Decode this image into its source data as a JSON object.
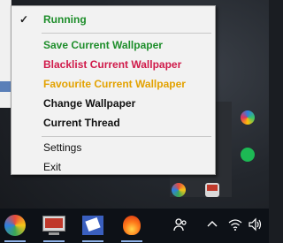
{
  "menu": {
    "items": [
      {
        "label": "Running",
        "color": "#1e8e2b",
        "bold": true,
        "checked": true
      },
      {
        "label": "Save Current Wallpaper",
        "color": "#1e8e2b",
        "bold": true
      },
      {
        "label": "Blacklist Current Wallpaper",
        "color": "#d01a4a",
        "bold": true
      },
      {
        "label": "Favourite Current Wallpaper",
        "color": "#e3a200",
        "bold": true
      },
      {
        "label": "Change Wallpaper",
        "color": "#111111",
        "bold": true
      },
      {
        "label": "Current Thread",
        "color": "#111111",
        "bold": true
      },
      {
        "label": "Settings",
        "color": "#111111",
        "bold": false
      },
      {
        "label": "Exit",
        "color": "#111111",
        "bold": false
      }
    ],
    "check_glyph": "✓"
  },
  "tray": {
    "people_icon": "people-icon",
    "chevron_icon": "chevron-up-icon",
    "wifi_icon": "wifi-icon",
    "volume_icon": "volume-icon"
  },
  "taskbar": {
    "apps": [
      "app-flower-icon",
      "app-monitor-icon",
      "app-paint-icon",
      "app-fire-icon"
    ]
  }
}
